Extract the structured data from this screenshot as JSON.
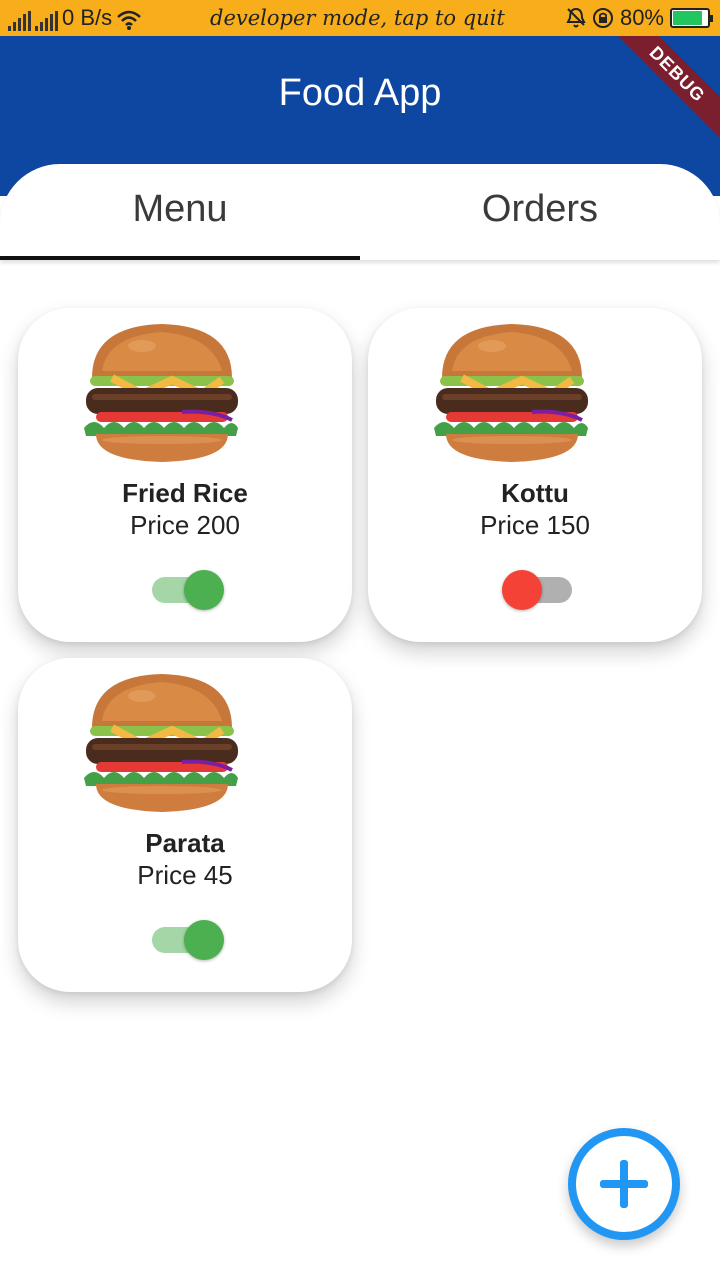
{
  "status_bar": {
    "net_speed": "0 B/s",
    "developer_text": "developer mode, tap to quit",
    "battery": "80%",
    "battery_level": 0.8
  },
  "app_bar": {
    "title": "Food App",
    "debug_label": "DEBUG"
  },
  "tabs": [
    {
      "label": "Menu",
      "selected": true
    },
    {
      "label": "Orders",
      "selected": false
    }
  ],
  "menu_items": [
    {
      "name": "Fried Rice",
      "price": "Price 200",
      "available": true
    },
    {
      "name": "Kottu",
      "price": "Price 150",
      "available": false
    },
    {
      "name": "Parata",
      "price": "Price 45",
      "available": true
    }
  ],
  "fab": {
    "icon": "plus-icon"
  },
  "colors": {
    "status_bar": "#f8ad1b",
    "app_bar": "#0d47a1",
    "switch_on": "#4caf50",
    "switch_off": "#f44336",
    "fab_accent": "#2196f3"
  }
}
